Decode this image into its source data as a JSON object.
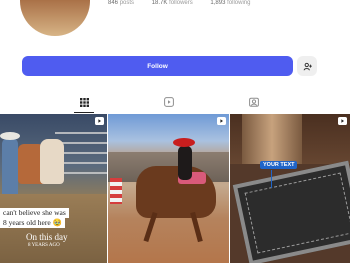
{
  "profile": {
    "stats": [
      {
        "value": "846",
        "label": "posts"
      },
      {
        "value": "18.7K",
        "label": "followers"
      },
      {
        "value": "1,893",
        "label": "following"
      }
    ]
  },
  "actions": {
    "follow_label": "Follow",
    "follow_color": "#4f5cf0"
  },
  "tabs": [
    {
      "icon": "grid-icon",
      "active": true
    },
    {
      "icon": "reels-icon",
      "active": false
    },
    {
      "icon": "tagged-icon",
      "active": false
    }
  ],
  "posts": [
    {
      "type_icon": "reel-icon",
      "caption_lines": [
        "can't believe she was",
        "8 years old here 🥹"
      ],
      "overlay_title": "On this day",
      "overlay_subtitle": "8 YEARS AGO"
    },
    {
      "type_icon": "reel-icon"
    },
    {
      "type_icon": "reel-icon",
      "tag_label": "YOUR TEXT"
    }
  ]
}
